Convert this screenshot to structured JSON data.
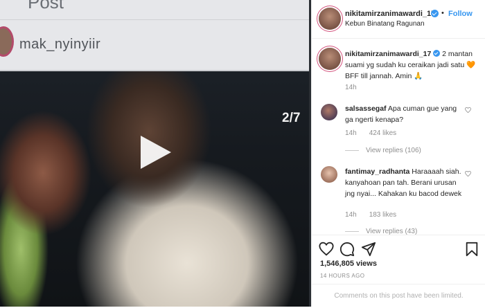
{
  "video": {
    "post_heading": "Post",
    "embedded_username": "mak_nyinyiir",
    "slide_counter": "2/7"
  },
  "header": {
    "username": "nikitamirzanimawardi_17",
    "separator": "•",
    "follow_label": "Follow",
    "location": "Kebun Binatang Ragunan"
  },
  "caption": {
    "username": "nikitamirzanimawardi_17",
    "text": "2 mantan suami yg sudah ku ceraikan jadi satu 🧡BFF till jannah. Amin 🙏",
    "time": "14h"
  },
  "comments": [
    {
      "username": "salsassegaf",
      "text": "Apa cuman gue yang ga ngerti kenapa?",
      "time": "14h",
      "likes": "424 likes",
      "replies": "View replies (106)"
    },
    {
      "username": "fantimay_radhanta",
      "text": "Haraaaah siah. kanyahoan pan tah. Berani urusan jng nyai... Kahakan ku bacod dewek",
      "time": "14h",
      "likes": "183 likes",
      "replies": "View replies (43)"
    }
  ],
  "stats": {
    "views": "1,546,805 views",
    "posted": "14 HOURS AGO"
  },
  "footer": {
    "notice": "Comments on this post have been limited."
  },
  "colors": {
    "accent": "#3897f0",
    "text": "#262626",
    "muted": "#8e8e8e"
  }
}
